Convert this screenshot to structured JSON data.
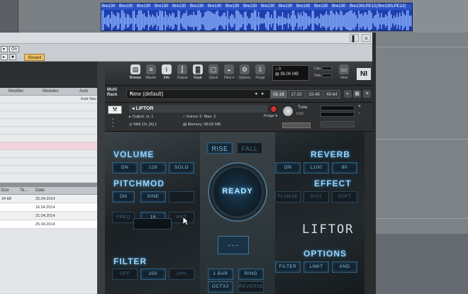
{
  "daw": {
    "clip_labels": [
      "Bre130",
      "Bre130",
      "Bre130",
      "Bre130",
      "Bre130",
      "Bre130",
      "Bre130",
      "Bre130",
      "Bre130",
      "Bre130",
      "Bre130",
      "Bre130",
      "Bre130",
      "Bre130",
      "Bre130LPE12(",
      "Bre130LPE12("
    ],
    "clip_color": "#1d3fae"
  },
  "host": {
    "on_label": "On",
    "xboard_label": "Xboard",
    "window_pin": "▌",
    "window_close": "×"
  },
  "browser": {
    "columns": [
      "Modifier",
      "Modules",
      "Auto"
    ],
    "sub_column": "Instr Nav",
    "file_columns": [
      "Size",
      "Te...",
      "Date"
    ],
    "files": [
      {
        "size": "34 kB",
        "date": "25.04.2014"
      },
      {
        "size": "",
        "date": "16.04.2014"
      },
      {
        "size": "",
        "date": "21.04.2014"
      },
      {
        "size": "",
        "date": "25.04.2014"
      }
    ]
  },
  "kontakt": {
    "toolbar": [
      {
        "label": "Browse",
        "icon": "browse-icon",
        "glyph": "▤",
        "active": true
      },
      {
        "label": "Master",
        "icon": "master-icon",
        "glyph": "≡",
        "active": false
      },
      {
        "label": "Info",
        "icon": "info-icon",
        "glyph": "i",
        "active": true
      },
      {
        "label": "Output",
        "icon": "output-icon",
        "glyph": "┇",
        "active": false
      },
      {
        "label": "Keyb",
        "icon": "keyboard-icon",
        "glyph": "▓",
        "active": true
      },
      {
        "label": "Quick",
        "icon": "quick-icon",
        "glyph": "▢",
        "active": false
      },
      {
        "label": "Files ▾",
        "icon": "disk-icon",
        "glyph": "◒",
        "active": false
      },
      {
        "label": "Options",
        "icon": "gear-icon",
        "glyph": "⚙",
        "active": false
      },
      {
        "label": "Purge",
        "icon": "purge-icon",
        "glyph": "⇩",
        "active": false
      }
    ],
    "cpu": {
      "voices": "0",
      "memory": "98.06 MB"
    },
    "meters": {
      "cpu_label": "Cpu",
      "disk_label": "Disk"
    },
    "view_label": "View",
    "logo": "NI",
    "rack": {
      "label": "Multi Rack",
      "name": "New (default)",
      "tabs": [
        "01-16",
        "17-32",
        "33-48",
        "49-64"
      ],
      "active_tab": 0
    },
    "instrument": {
      "name": "LIFTOR",
      "output_label": "Output:",
      "output_value": "st. 1",
      "voices_label": "Voices:",
      "voices_value": "0",
      "max_label": "Max:",
      "max_value": "2",
      "purge_label": "Purge",
      "midi_label": "Midi Ch:",
      "midi_value": "[A] 1",
      "memory_label": "Memory:",
      "memory_value": "98.06 MB",
      "tune_label": "Tune",
      "tune_value": "0.00"
    }
  },
  "liftor": {
    "sections": {
      "volume": "VOLUME",
      "pitchmod": "PITCHMOD",
      "filter": "FILTER",
      "reverb": "REVERB",
      "effect": "EFFECT",
      "options": "OPTIONS"
    },
    "volume_buttons": [
      "ON",
      "128",
      "SOLO"
    ],
    "pitchmod_buttons": [
      "ON",
      "SINE",
      ""
    ],
    "pitchmod_row2": [
      "FREQ",
      "16",
      "AMT"
    ],
    "filter_buttons": [
      "OFF",
      "250",
      "24%"
    ],
    "reverb_buttons": [
      "ON",
      "L100",
      "80"
    ],
    "effect_buttons": [
      "FLANGE",
      "DIST",
      "SOFT"
    ],
    "options_buttons": [
      "FILTER",
      "LIMIT",
      "AND"
    ],
    "rise_label": "RISE",
    "fall_label": "FALL",
    "ready_label": "READY",
    "dashes_label": "- - -",
    "length_label": "1 BAR",
    "octave_label": "OCTX2",
    "ring_label": "RING",
    "reverse_label": "REVERSE",
    "logo_text": "LIFTOR",
    "accent_color": "#7fc7f2"
  }
}
